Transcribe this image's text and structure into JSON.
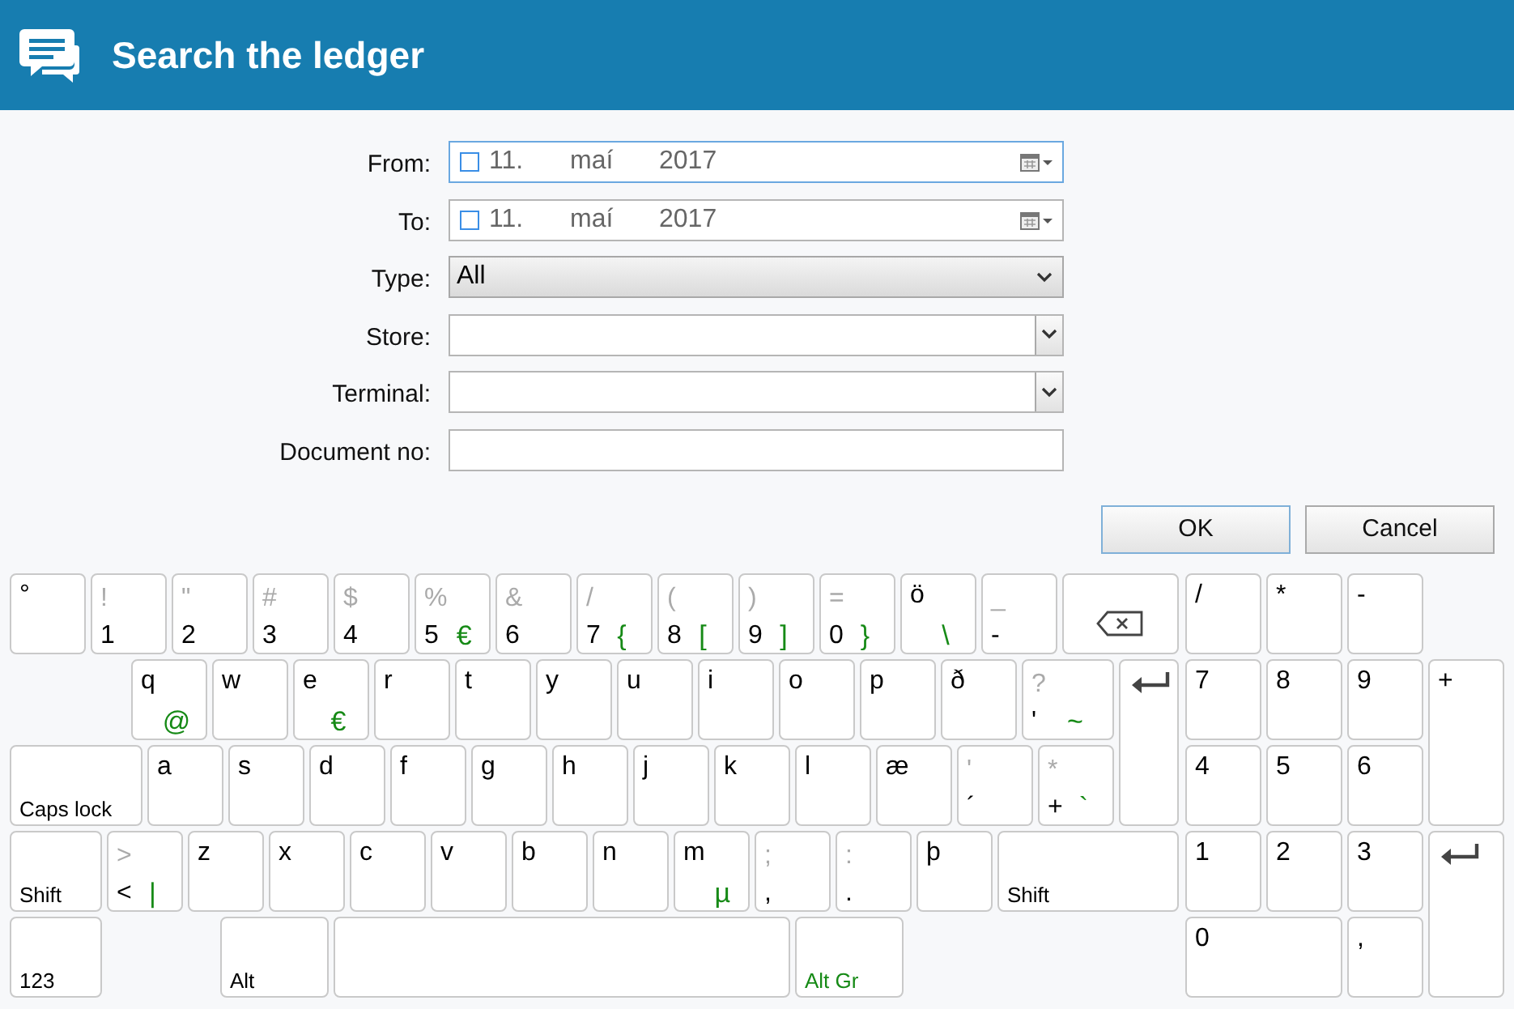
{
  "header": {
    "title": "Search the ledger"
  },
  "form": {
    "fields": [
      {
        "kind": "date",
        "label": "From:",
        "day": "11.",
        "month": "maí",
        "year": "2017",
        "checked": false,
        "focused": true
      },
      {
        "kind": "date",
        "label": "To:",
        "day": "11.",
        "month": "maí",
        "year": "2017",
        "checked": false,
        "focused": false
      },
      {
        "kind": "select",
        "label": "Type:",
        "value": "All"
      },
      {
        "kind": "combo",
        "label": "Store:"
      },
      {
        "kind": "combo",
        "label": "Terminal:"
      },
      {
        "kind": "text",
        "label": "Document no:"
      }
    ]
  },
  "buttons": [
    {
      "label": "OK",
      "default": true
    },
    {
      "label": "Cancel",
      "default": false
    }
  ],
  "keyboard": {
    "rows": [
      [
        {
          "kind": "letter",
          "base": "°"
        },
        {
          "kind": "digit",
          "shift": "!",
          "base": "1"
        },
        {
          "kind": "digit",
          "shift": "\"",
          "base": "2"
        },
        {
          "kind": "digit",
          "shift": "#",
          "base": "3"
        },
        {
          "kind": "digit",
          "shift": "$",
          "base": "4"
        },
        {
          "kind": "digit",
          "shift": "%",
          "base": "5",
          "altgr": "€"
        },
        {
          "kind": "digit",
          "shift": "&",
          "base": "6"
        },
        {
          "kind": "digit",
          "shift": "/",
          "base": "7",
          "altgr": "{"
        },
        {
          "kind": "digit",
          "shift": "(",
          "base": "8",
          "altgr": "["
        },
        {
          "kind": "digit",
          "shift": ")",
          "base": "9",
          "altgr": "]"
        },
        {
          "kind": "digit",
          "shift": "=",
          "base": "0",
          "altgr": "}"
        },
        {
          "kind": "letter",
          "base": "ö",
          "altgr": "\\"
        },
        {
          "kind": "digit",
          "shift": "_",
          "base": "-"
        },
        {
          "kind": "backspace"
        }
      ],
      [
        {
          "kind": "letter",
          "base": "q",
          "altgr": "@"
        },
        {
          "kind": "letter",
          "base": "w"
        },
        {
          "kind": "letter",
          "base": "e",
          "altgr": "€"
        },
        {
          "kind": "letter",
          "base": "r"
        },
        {
          "kind": "letter",
          "base": "t"
        },
        {
          "kind": "letter",
          "base": "y"
        },
        {
          "kind": "letter",
          "base": "u"
        },
        {
          "kind": "letter",
          "base": "i"
        },
        {
          "kind": "letter",
          "base": "o"
        },
        {
          "kind": "letter",
          "base": "p"
        },
        {
          "kind": "letter",
          "base": "ð"
        },
        {
          "kind": "digit",
          "shift": "?",
          "base": "'",
          "altgr": "~"
        },
        {
          "kind": "enter"
        }
      ],
      [
        {
          "kind": "modifier",
          "label": "Caps lock"
        },
        {
          "kind": "letter",
          "base": "a"
        },
        {
          "kind": "letter",
          "base": "s"
        },
        {
          "kind": "letter",
          "base": "d"
        },
        {
          "kind": "letter",
          "base": "f"
        },
        {
          "kind": "letter",
          "base": "g"
        },
        {
          "kind": "letter",
          "base": "h"
        },
        {
          "kind": "letter",
          "base": "j"
        },
        {
          "kind": "letter",
          "base": "k"
        },
        {
          "kind": "letter",
          "base": "l"
        },
        {
          "kind": "letter",
          "base": "æ"
        },
        {
          "kind": "digit",
          "shift": "'",
          "base": "´"
        },
        {
          "kind": "digit",
          "shift": "*",
          "base": "+",
          "altgr": "`"
        }
      ],
      [
        {
          "kind": "modifier",
          "label": "Shift"
        },
        {
          "kind": "digit",
          "shift": ">",
          "base": "<",
          "altgr": "|"
        },
        {
          "kind": "letter",
          "base": "z"
        },
        {
          "kind": "letter",
          "base": "x"
        },
        {
          "kind": "letter",
          "base": "c"
        },
        {
          "kind": "letter",
          "base": "v"
        },
        {
          "kind": "letter",
          "base": "b"
        },
        {
          "kind": "letter",
          "base": "n"
        },
        {
          "kind": "letter",
          "base": "m",
          "altgr": "µ"
        },
        {
          "kind": "digit",
          "shift": ";",
          "base": ","
        },
        {
          "kind": "digit",
          "shift": ":",
          "base": "."
        },
        {
          "kind": "letter",
          "base": "þ"
        },
        {
          "kind": "modifier",
          "label": "Shift"
        }
      ],
      [
        {
          "kind": "modifier",
          "label": "123"
        },
        {
          "kind": "modifier",
          "label": "Alt"
        },
        {
          "kind": "space"
        },
        {
          "kind": "altgr",
          "label": "Alt Gr"
        }
      ]
    ],
    "numpad": [
      {
        "kind": "letter",
        "base": "/"
      },
      {
        "kind": "letter",
        "base": "*"
      },
      {
        "kind": "letter",
        "base": "-"
      },
      {
        "kind": "letter",
        "base": "7"
      },
      {
        "kind": "letter",
        "base": "8"
      },
      {
        "kind": "letter",
        "base": "9"
      },
      {
        "kind": "letter",
        "base": "+"
      },
      {
        "kind": "letter",
        "base": "4"
      },
      {
        "kind": "letter",
        "base": "5"
      },
      {
        "kind": "letter",
        "base": "6"
      },
      {
        "kind": "letter",
        "base": "1"
      },
      {
        "kind": "letter",
        "base": "2"
      },
      {
        "kind": "letter",
        "base": "3"
      },
      {
        "kind": "enter"
      },
      {
        "kind": "letter",
        "base": "0"
      },
      {
        "kind": "letter",
        "base": ","
      }
    ]
  }
}
